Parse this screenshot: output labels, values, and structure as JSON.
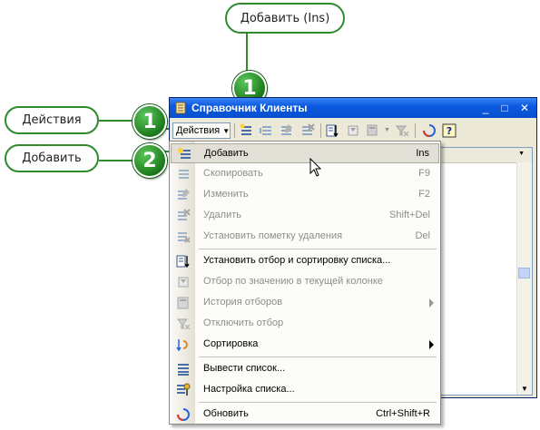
{
  "callouts": {
    "top_label": "Добавить (Ins)",
    "left_label_1": "Действия",
    "left_label_2": "Добавить",
    "num_1a": "1",
    "num_1b": "1",
    "num_2": "2",
    "color": "#2e8b2e"
  },
  "window": {
    "title": "Справочник Клиенты",
    "title_icon": "catalog-icon",
    "controls": {
      "minimize": "_",
      "maximize": "□",
      "close": "✕"
    }
  },
  "toolbar": {
    "actions_label": "Действия",
    "icons": [
      "add-icon",
      "add-group-icon",
      "edit-icon",
      "delete-icon",
      "filter-icon",
      "filter-by-value-icon",
      "filter-history-icon",
      "clear-filter-icon",
      "refresh-icon",
      "help-icon"
    ]
  },
  "menu": {
    "items": [
      {
        "label": "Добавить",
        "shortcut": "Ins",
        "icon": "add-icon",
        "disabled": false,
        "selected": true
      },
      {
        "label": "Скопировать",
        "shortcut": "F9",
        "icon": "copy-icon",
        "disabled": true
      },
      {
        "label": "Изменить",
        "shortcut": "F2",
        "icon": "edit-icon",
        "disabled": true
      },
      {
        "label": "Удалить",
        "shortcut": "Shift+Del",
        "icon": "delete-icon",
        "disabled": true
      },
      {
        "label": "Установить пометку удаления",
        "shortcut": "Del",
        "icon": "mark-delete-icon",
        "disabled": true
      },
      {
        "label": "Установить отбор и сортировку списка...",
        "shortcut": "",
        "icon": "filter-sort-icon",
        "disabled": false
      },
      {
        "label": "Отбор по значению в текущей колонке",
        "shortcut": "",
        "icon": "filter-by-value-icon",
        "disabled": true
      },
      {
        "label": "История отборов",
        "shortcut": "",
        "icon": "filter-history-icon",
        "disabled": true,
        "submenu": true
      },
      {
        "label": "Отключить отбор",
        "shortcut": "",
        "icon": "clear-filter-icon",
        "disabled": true
      },
      {
        "label": "Сортировка",
        "shortcut": "",
        "icon": "sort-icon",
        "disabled": false,
        "submenu": true
      },
      {
        "label": "Вывести список...",
        "shortcut": "",
        "icon": "output-list-icon",
        "disabled": false
      },
      {
        "label": "Настройка списка...",
        "shortcut": "",
        "icon": "list-settings-icon",
        "disabled": false
      },
      {
        "label": "Обновить",
        "shortcut": "Ctrl+Shift+R",
        "icon": "refresh-icon",
        "disabled": false
      }
    ]
  }
}
